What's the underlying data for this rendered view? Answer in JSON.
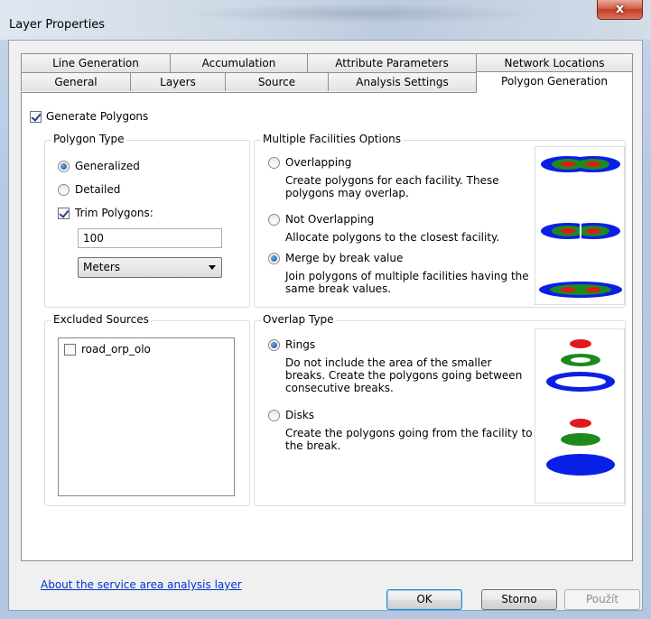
{
  "window": {
    "title": "Layer Properties",
    "close_glyph": "x"
  },
  "tabs": {
    "row_back": [
      "Line Generation",
      "Accumulation",
      "Attribute Parameters",
      "Network Locations"
    ],
    "row_front": [
      "General",
      "Layers",
      "Source",
      "Analysis Settings",
      "Polygon Generation"
    ],
    "active": "Polygon Generation"
  },
  "generate_polygons": {
    "label": "Generate Polygons",
    "checked": true
  },
  "polygon_type": {
    "title": "Polygon Type",
    "generalized_label": "Generalized",
    "detailed_label": "Detailed",
    "selected": "Generalized",
    "trim_label": "Trim Polygons:",
    "trim_checked": true,
    "trim_value": "100",
    "units_value": "Meters"
  },
  "multiple_facilities": {
    "title": "Multiple Facilities Options",
    "overlapping_label": "Overlapping",
    "overlapping_desc": "Create polygons for each facility. These polygons may overlap.",
    "not_overlapping_label": "Not Overlapping",
    "not_overlapping_desc": "Allocate polygons to the closest facility.",
    "merge_label": "Merge by break value",
    "merge_desc": "Join polygons of multiple facilities having the same break values.",
    "selected": "Merge by break value"
  },
  "excluded_sources": {
    "title": "Excluded Sources",
    "items": [
      {
        "label": "road_orp_olo",
        "checked": false
      }
    ]
  },
  "overlap_type": {
    "title": "Overlap Type",
    "rings_label": "Rings",
    "rings_desc": "Do not include the area of the smaller breaks. Create the polygons going between consecutive breaks.",
    "disks_label": "Disks",
    "disks_desc": "Create the polygons going from the facility to the break.",
    "selected": "Rings"
  },
  "about_link": "About the service area analysis layer",
  "buttons": {
    "ok": "OK",
    "cancel": "Storno",
    "apply": "Použít"
  },
  "colors": {
    "blue": "#0a1fe6",
    "green": "#1e8a1e",
    "red": "#e01a1a",
    "link": "#0033cc"
  }
}
